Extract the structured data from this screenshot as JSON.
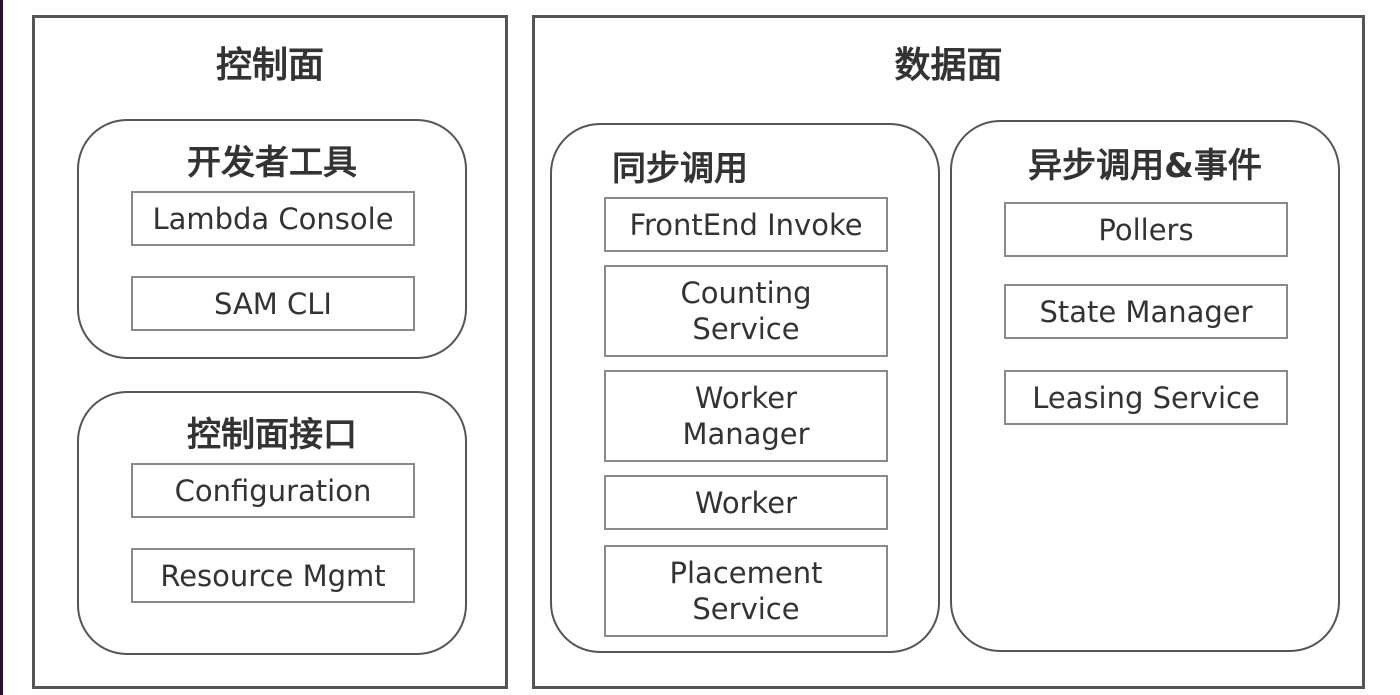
{
  "control_plane": {
    "title": "控制面",
    "groups": [
      {
        "title": "开发者工具",
        "components": [
          "Lambda Console",
          "SAM CLI"
        ]
      },
      {
        "title": "控制面接口",
        "components": [
          "Configuration",
          "Resource Mgmt"
        ]
      }
    ]
  },
  "data_plane": {
    "title": "数据面",
    "groups": [
      {
        "title": "同步调用",
        "components": [
          "FrontEnd Invoke",
          "Counting\nService",
          "Worker\nManager",
          "Worker",
          "Placement\nService"
        ]
      },
      {
        "title": "异步调用&事件",
        "components": [
          "Pollers",
          "State Manager",
          "Leasing Service"
        ]
      }
    ]
  }
}
